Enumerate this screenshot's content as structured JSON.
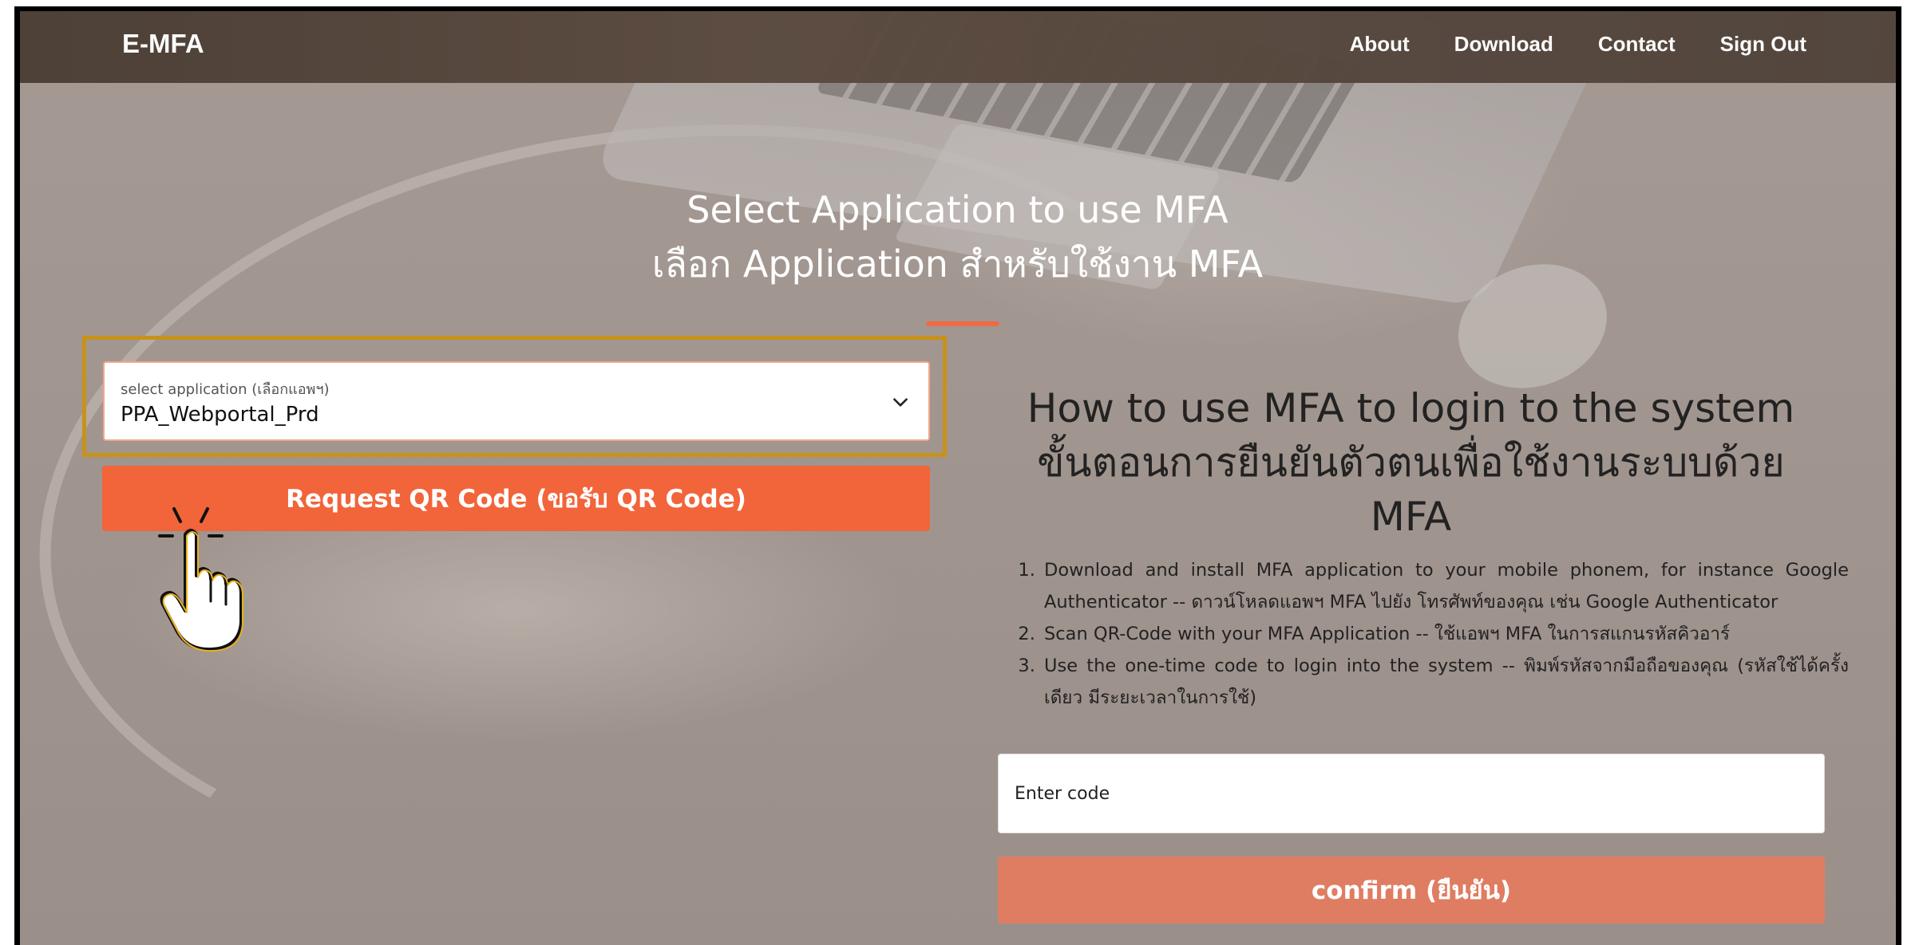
{
  "app": {
    "brand": "E-MFA"
  },
  "nav": {
    "items": [
      "About",
      "Download",
      "Contact",
      "Sign Out"
    ]
  },
  "main": {
    "title_en": "Select Application to use MFA",
    "title_th": "เลือก Application สำหรับใช้งาน MFA"
  },
  "select": {
    "caption": "select application (เลือกแอพฯ)",
    "value": "PPA_Webportal_Prd"
  },
  "request_button": {
    "label": "Request QR Code (ขอรับ QR Code)"
  },
  "howto": {
    "title_lines": [
      "How to use MFA to login to the system",
      "ขั้นตอนการยืนยันตัวตนเพื่อใช้งานระบบด้วย",
      "MFA"
    ],
    "steps": [
      "Download and install MFA application to your mobile phonem, for instance Google Authenticator -- ดาวน์โหลดแอพฯ MFA ไปยัง โทรศัพท์ของคุณ เช่น Google Authenticator",
      "Scan QR-Code with your MFA Application -- ใช้แอพฯ MFA ในการสแกนรหัสคิวอาร์",
      "Use the one-time code to login into the system -- พิมพ์รหัสจากมือถือของคุณ (รหัสใช้ได้ครั้งเดียว มีระยะเวลาในการใช้)"
    ]
  },
  "code_input": {
    "placeholder": "Enter code"
  },
  "confirm_button": {
    "label": "confirm (ยืนยัน)"
  },
  "colors": {
    "accent": "#f2643a",
    "confirm": "#df7d63",
    "highlight": "#c8921a",
    "topbar": "#51443b"
  },
  "icons": {
    "select": "chevron-down-icon",
    "pointer": "hand-pointer-icon"
  }
}
